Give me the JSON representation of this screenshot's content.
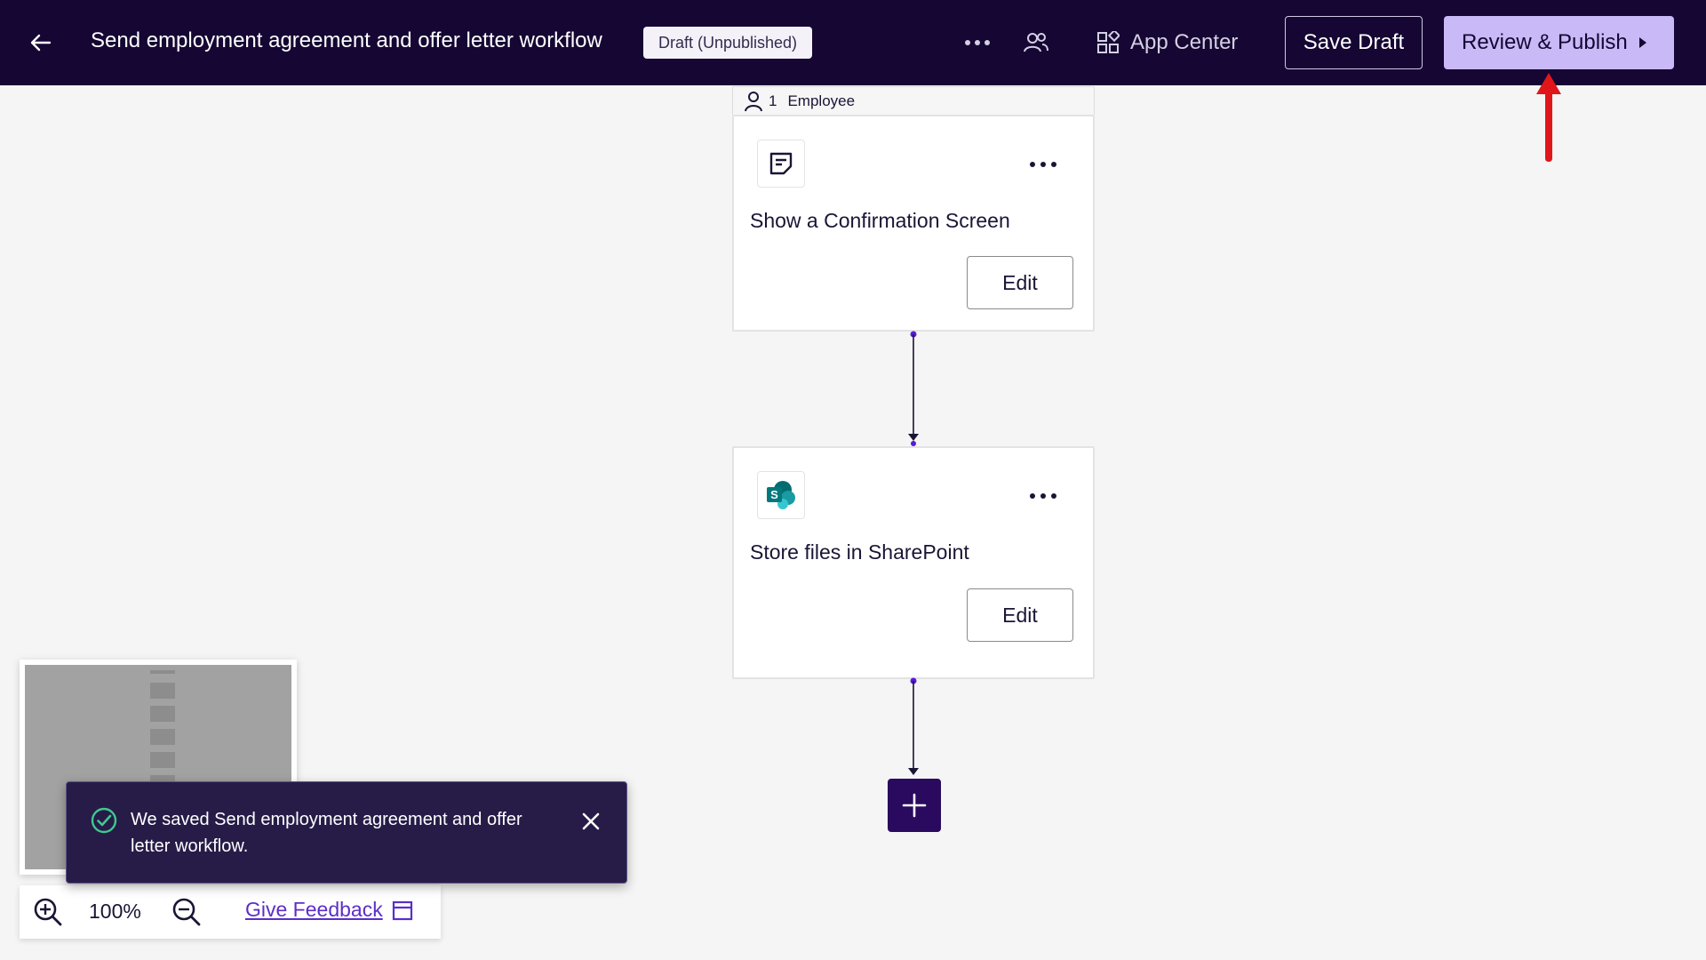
{
  "header": {
    "workflow_title": "Send employment agreement and offer letter workflow",
    "status_badge": "Draft (Unpublished)",
    "app_center_label": "App Center",
    "save_draft_label": "Save Draft",
    "publish_label": "Review & Publish"
  },
  "flow": {
    "step_header": {
      "count": "1",
      "role": "Employee"
    },
    "cards": [
      {
        "title": "Show a Confirmation Screen",
        "icon": "confirmation-screen-icon",
        "edit_label": "Edit"
      },
      {
        "title": "Store files in SharePoint",
        "icon": "sharepoint-icon",
        "edit_label": "Edit"
      }
    ]
  },
  "zoom": {
    "level": "100%",
    "feedback_label": "Give Feedback"
  },
  "toast": {
    "message": "We saved Send employment agreement and offer letter workflow."
  },
  "colors": {
    "topbar": "#150633",
    "publish_button": "#c9b9f7",
    "add_button": "#2a0a5e",
    "annotation_arrow": "#e0161b",
    "toast_bg": "#271c48",
    "success_check": "#3fc98f"
  }
}
